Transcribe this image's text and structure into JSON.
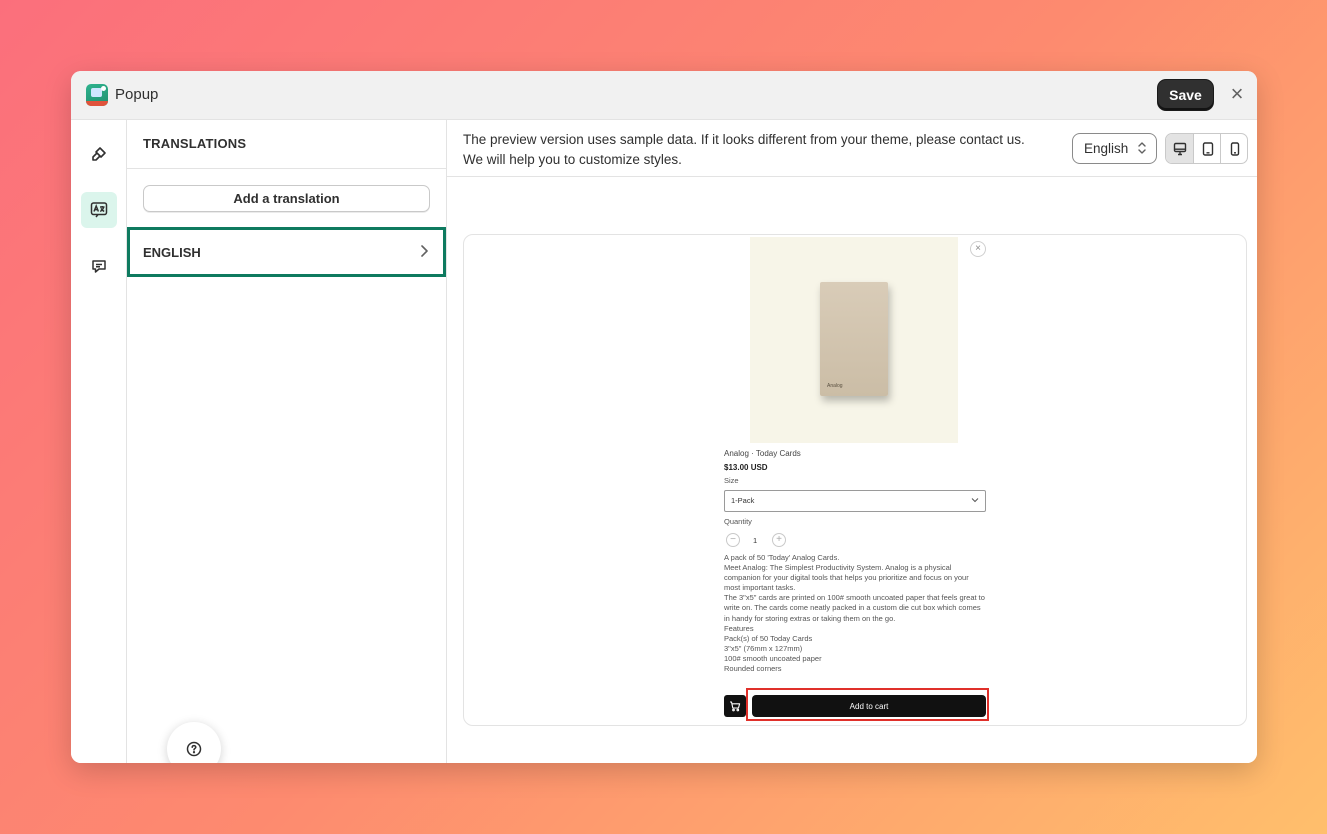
{
  "window": {
    "title": "Popup",
    "save_label": "Save",
    "close_icon": "close-icon"
  },
  "rail": {
    "items": [
      {
        "icon": "brush-icon",
        "active": false
      },
      {
        "icon": "translate-icon",
        "active": true
      },
      {
        "icon": "comment-icon",
        "active": false
      }
    ]
  },
  "translations": {
    "heading": "TRANSLATIONS",
    "add_label": "Add a translation",
    "items": [
      {
        "label": "ENGLISH",
        "selected": true
      }
    ]
  },
  "main": {
    "notice_line1": "The preview version uses sample data. If it looks different from your theme, please contact us.",
    "notice_line2": "We will help you to customize styles.",
    "language_select": "English",
    "devices": [
      "desktop-icon",
      "tablet-icon",
      "mobile-icon"
    ],
    "active_device": "desktop-icon"
  },
  "preview": {
    "box_text": "Analog",
    "product_title": "Analog · Today Cards",
    "price": "$13.00 USD",
    "size_label": "Size",
    "size_value": "1-Pack",
    "quantity_label": "Quantity",
    "quantity": "1",
    "description": [
      "A pack of 50 'Today' Analog Cards.",
      "Meet Analog: The Simplest Productivity System. Analog is a physical",
      "companion for your digital tools that helps you prioritize and focus on your",
      "most important tasks.",
      "The 3\"x5\" cards are printed on 100# smooth uncoated paper that feels great to",
      "write on. The cards come neatly packed in a custom die cut box which comes",
      "in handy for storing extras or taking them on the go.",
      "Features",
      "Pack(s) of 50 Today Cards",
      "3\"x5\" (76mm x 127mm)",
      "100# smooth uncoated paper",
      "Rounded corners"
    ],
    "add_to_cart": "Add to cart"
  },
  "colors": {
    "accent": "#0e7a5f",
    "highlight": "#e0302a",
    "dark_button": "#303030"
  }
}
